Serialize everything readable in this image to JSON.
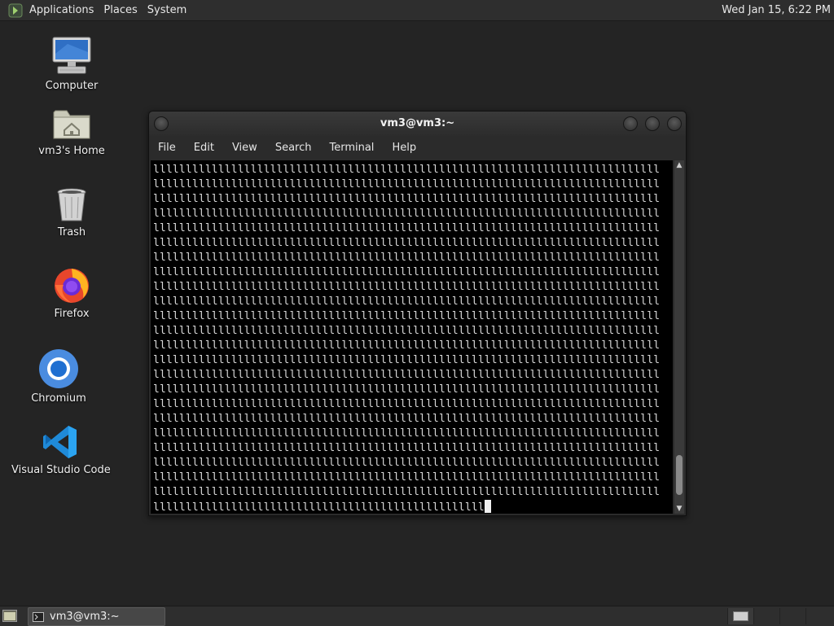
{
  "top_panel": {
    "menus": [
      "Applications",
      "Places",
      "System"
    ],
    "clock": "Wed Jan 15,  6:22 PM"
  },
  "desktop": {
    "icons": [
      {
        "label": "Computer",
        "icon": "computer-icon"
      },
      {
        "label": "vm3's Home",
        "icon": "home-folder-icon"
      },
      {
        "label": "Trash",
        "icon": "trash-icon"
      },
      {
        "label": "Firefox",
        "icon": "firefox-icon"
      },
      {
        "label": "Chromium",
        "icon": "chromium-icon"
      },
      {
        "label": "Visual Studio Code",
        "icon": "vscode-icon"
      }
    ]
  },
  "terminal": {
    "title": "vm3@vm3:~",
    "menu": [
      "File",
      "Edit",
      "View",
      "Search",
      "Terminal",
      "Help"
    ],
    "fill_char": "l",
    "full_line_count": 23,
    "chars_per_line": 78,
    "last_line_chars": 51,
    "scroll_position": 0.97,
    "scroll_visible_fraction": 0.12
  },
  "taskbar": {
    "task_label": "vm3@vm3:~",
    "workspaces": 4,
    "active_workspace": 1
  },
  "colors": {
    "desktop_bg": "#242424",
    "panel_bg": "#2e2e2e",
    "terminal_bg": "#000000",
    "terminal_fg": "#d8d8d8"
  }
}
